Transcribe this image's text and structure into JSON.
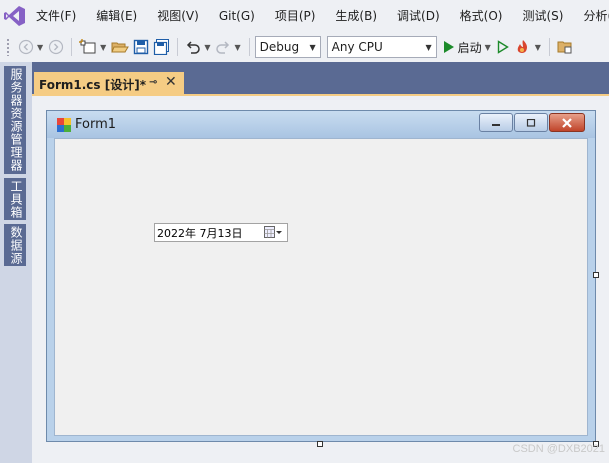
{
  "menu": {
    "items": [
      "文件(F)",
      "编辑(E)",
      "视图(V)",
      "Git(G)",
      "项目(P)",
      "生成(B)",
      "调试(D)",
      "格式(O)",
      "测试(S)",
      "分析(N"
    ]
  },
  "toolbar": {
    "config_value": "Debug",
    "platform_value": "Any CPU",
    "start_label": "启动"
  },
  "side_tabs": {
    "server_explorer": "服务器资源管理器",
    "toolbox": "工具箱",
    "data_sources": "数据源"
  },
  "document_tab": {
    "title": "Form1.cs [设计]*"
  },
  "form": {
    "title": "Form1",
    "datetimepicker_value": "2022年  7月13日"
  },
  "watermark": "CSDN @DXB2021",
  "colors": {
    "accent_purple": "#68217a",
    "tab_active": "#f5cc84",
    "tab_well": "#5a6a93",
    "run_green": "#1c8a2a"
  }
}
